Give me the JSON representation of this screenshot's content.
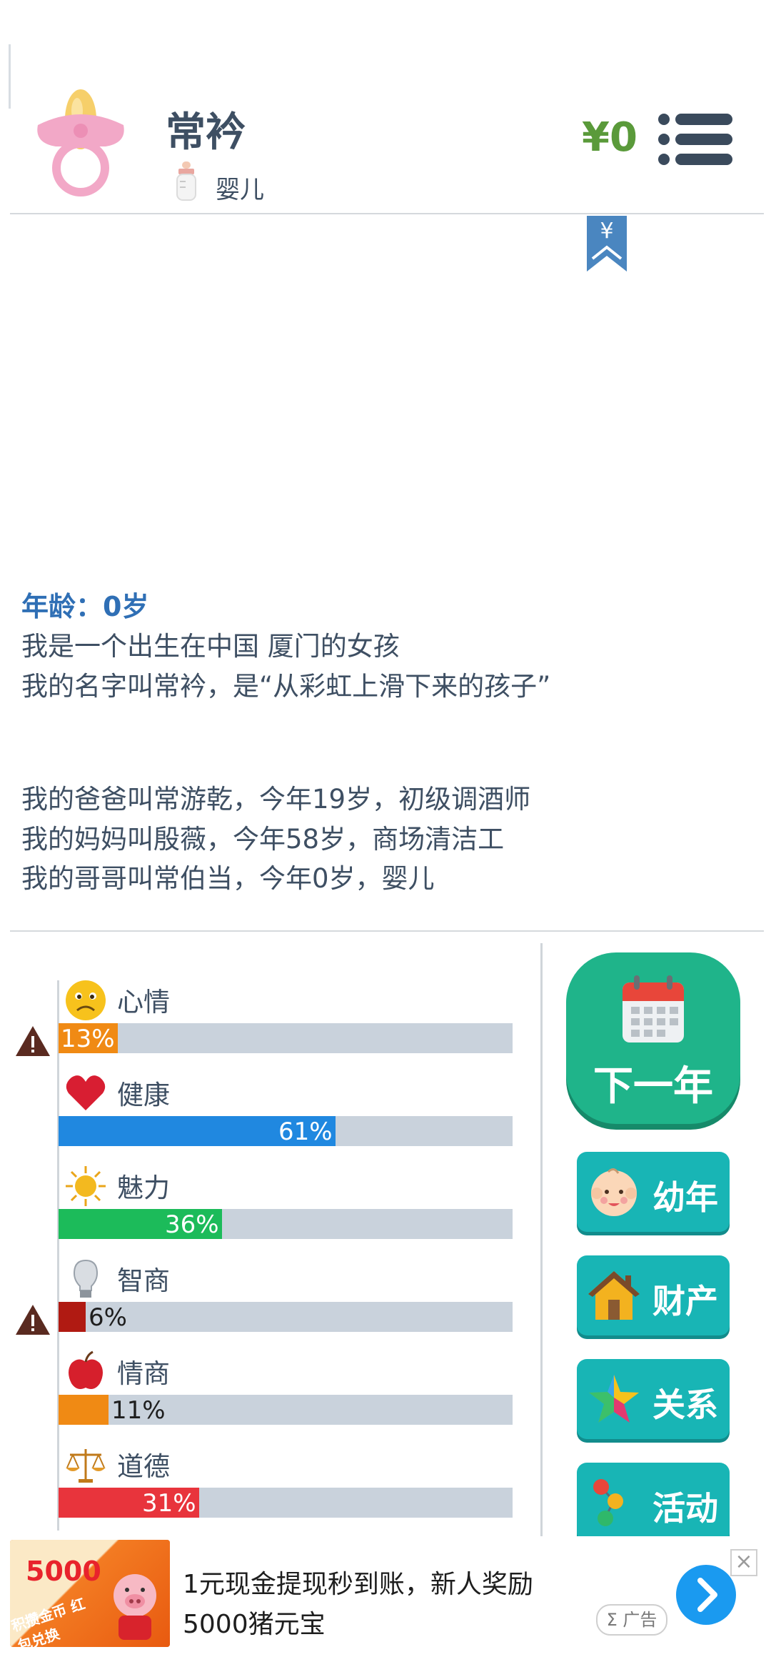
{
  "header": {
    "name": "常衿",
    "stage": "婴儿",
    "money": "¥0",
    "bookmark_symbol": "¥"
  },
  "story": {
    "age": "年龄：0岁",
    "lines": [
      "我是一个出生在中国 厦门的女孩",
      "我的名字叫常衿，是“从彩虹上滑下来的孩子”",
      "我的爸爸叫常游乾，今年19岁，初级调酒师",
      "我的妈妈叫殷薇，今年58岁，商场清洁工",
      "我的哥哥叫常伯当，今年0岁，婴儿"
    ]
  },
  "stats": [
    {
      "label": "心情",
      "value": "13%",
      "fraction": 0.13,
      "color": "#f08a14",
      "warning": true,
      "icon": "sad-face-icon"
    },
    {
      "label": "健康",
      "value": "61%",
      "fraction": 0.61,
      "color": "#2088e0",
      "warning": false,
      "icon": "heart-icon"
    },
    {
      "label": "魅力",
      "value": "36%",
      "fraction": 0.36,
      "color": "#1cbb5a",
      "warning": false,
      "icon": "sun-icon"
    },
    {
      "label": "智商",
      "value": "6%",
      "fraction": 0.06,
      "color": "#b01a12",
      "warning": true,
      "icon": "lightbulb-icon"
    },
    {
      "label": "情商",
      "value": "11%",
      "fraction": 0.11,
      "color": "#f08a14",
      "warning": false,
      "icon": "apple-icon"
    },
    {
      "label": "道德",
      "value": "31%",
      "fraction": 0.31,
      "color": "#e8343c",
      "warning": false,
      "icon": "scales-icon"
    }
  ],
  "actions": {
    "next_year": "下一年",
    "childhood": "幼年",
    "assets": "财产",
    "relations": "关系",
    "activities": "活动"
  },
  "ad": {
    "line1": "1元现金提现秒到账，新人奖励",
    "line2": "5000猪元宝",
    "badge": "Σ 广告",
    "close": "×",
    "image_amount": "5000",
    "image_caption": "积攒金币 红包兑换"
  }
}
